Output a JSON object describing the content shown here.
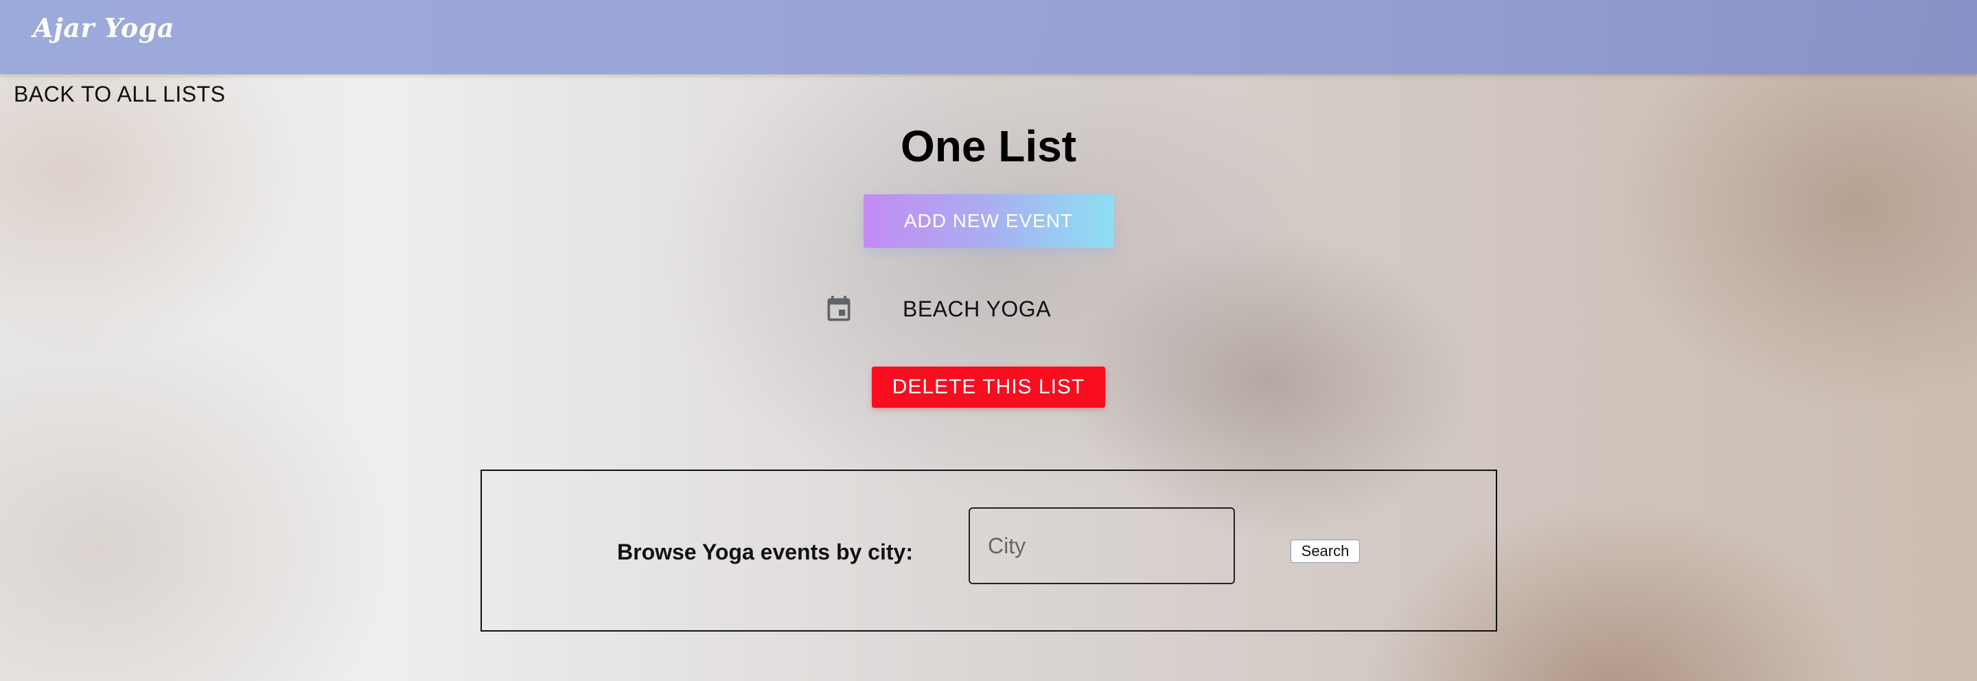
{
  "navbar": {
    "brand": "Ajar Yoga"
  },
  "nav": {
    "back_label": "BACK TO ALL LISTS"
  },
  "list": {
    "title": "One List",
    "add_event_label": "ADD NEW EVENT",
    "events": [
      {
        "name": "BEACH YOGA",
        "icon": "calendar-icon"
      }
    ],
    "delete_label": "DELETE THIS LIST"
  },
  "browse": {
    "label": "Browse Yoga events by city:",
    "city_placeholder": "City",
    "city_value": "",
    "search_label": "Search"
  },
  "colors": {
    "navbar": "#9aa8da",
    "add_button_start": "#c38bf2",
    "add_button_end": "#8de0f3",
    "delete_button": "#f90d1e",
    "calendar_icon": "#5f6368"
  }
}
